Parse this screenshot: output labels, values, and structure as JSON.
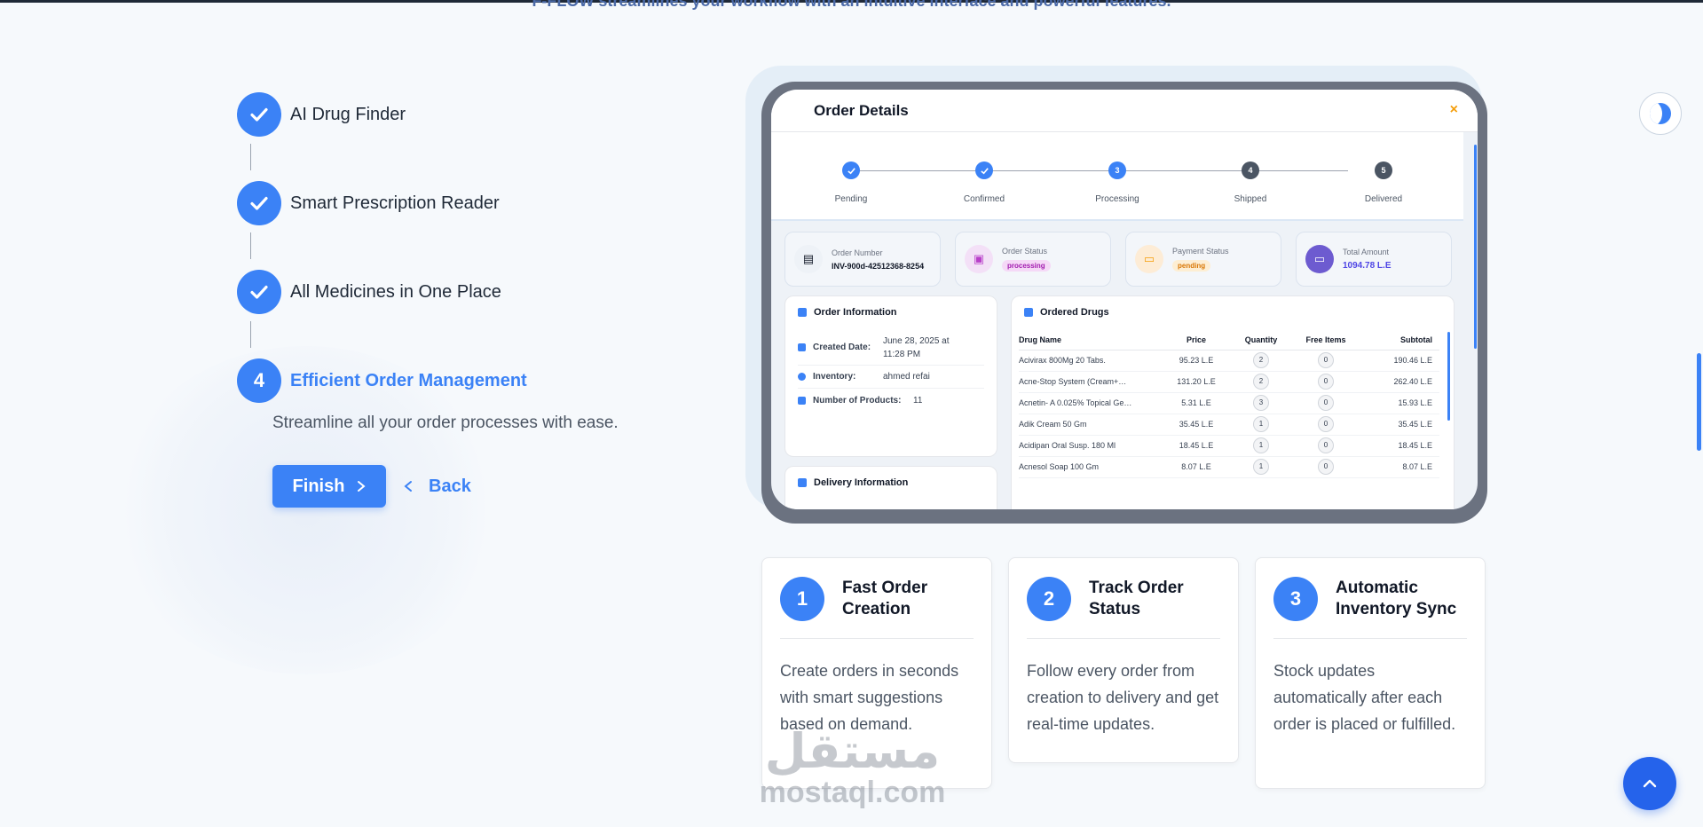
{
  "intro": {
    "text": "F-FLOW streamlines your workflow with an intuitive interface and powerful features."
  },
  "steps": [
    {
      "label": "AI Drug Finder",
      "state": "done",
      "icon": "check-icon"
    },
    {
      "label": "Smart Prescription Reader",
      "state": "done",
      "icon": "check-icon"
    },
    {
      "label": "All Medicines in One Place",
      "state": "done",
      "icon": "check-icon"
    },
    {
      "number": "4",
      "label": "Efficient Order Management",
      "state": "active"
    }
  ],
  "active_description": "Streamline all your order processes with ease.",
  "buttons": {
    "finish": "Finish",
    "back": "Back"
  },
  "order_details": {
    "title": "Order Details",
    "close": "×",
    "stepper": [
      {
        "label": "Pending",
        "state": "done"
      },
      {
        "label": "Confirmed",
        "state": "done"
      },
      {
        "number": "3",
        "label": "Processing",
        "state": "current"
      },
      {
        "number": "4",
        "label": "Shipped",
        "state": "todo"
      },
      {
        "number": "5",
        "label": "Delivered",
        "state": "todo"
      }
    ],
    "cards": {
      "order_number": {
        "label": "Order Number",
        "value": "INV-900d-42512368-8254"
      },
      "order_status": {
        "label": "Order Status",
        "value": "processing"
      },
      "payment_status": {
        "label": "Payment Status",
        "value": "pending"
      },
      "total_amount": {
        "label": "Total Amount",
        "value": "1094.78 L.E"
      }
    },
    "order_info": {
      "title": "Order Information",
      "created_label": "Created Date:",
      "created_value_1": "June 28, 2025 at",
      "created_value_2": "11:28 PM",
      "inventory_label": "Inventory:",
      "inventory_value": "ahmed refai",
      "products_label": "Number of Products:",
      "products_value": "11"
    },
    "delivery_info": {
      "title": "Delivery Information"
    },
    "ordered_drugs": {
      "title": "Ordered Drugs",
      "columns": [
        "Drug Name",
        "Price",
        "Quantity",
        "Free Items",
        "Subtotal"
      ],
      "rows": [
        [
          "Acivirax 800Mg 20 Tabs.",
          "95.23 L.E",
          "2",
          "0",
          "190.46 L.E"
        ],
        [
          "Acne-Stop System (Cream+…",
          "131.20 L.E",
          "2",
          "0",
          "262.40 L.E"
        ],
        [
          "Acnetin- A 0.025% Topical Ge…",
          "5.31 L.E",
          "3",
          "0",
          "15.93 L.E"
        ],
        [
          "Adik Cream 50 Gm",
          "35.45 L.E",
          "1",
          "0",
          "35.45 L.E"
        ],
        [
          "Acidipan Oral Susp. 180 Ml",
          "18.45 L.E",
          "1",
          "0",
          "18.45 L.E"
        ],
        [
          "Acnesol Soap 100 Gm",
          "8.07 L.E",
          "1",
          "0",
          "8.07 L.E"
        ]
      ]
    }
  },
  "features": [
    {
      "number": "1",
      "title_1": "Fast Order",
      "title_2": "Creation",
      "desc": "Create orders in seconds with smart suggestions based on demand."
    },
    {
      "number": "2",
      "title_1": "Track Order",
      "title_2": "Status",
      "desc": "Follow every order from creation to delivery and get real-time updates."
    },
    {
      "number": "3",
      "title_1": "Automatic",
      "title_2": "Inventory Sync",
      "desc": "Stock updates automatically after each order is placed or fulfilled."
    }
  ],
  "watermark": {
    "arabic": "مستقل",
    "latin": "mostaql.com"
  },
  "colors": {
    "accent": "#3b82f6",
    "text": "#1f2937",
    "muted": "#4b5563",
    "background": "#f6f9fc",
    "warning": "#f59e0b"
  }
}
